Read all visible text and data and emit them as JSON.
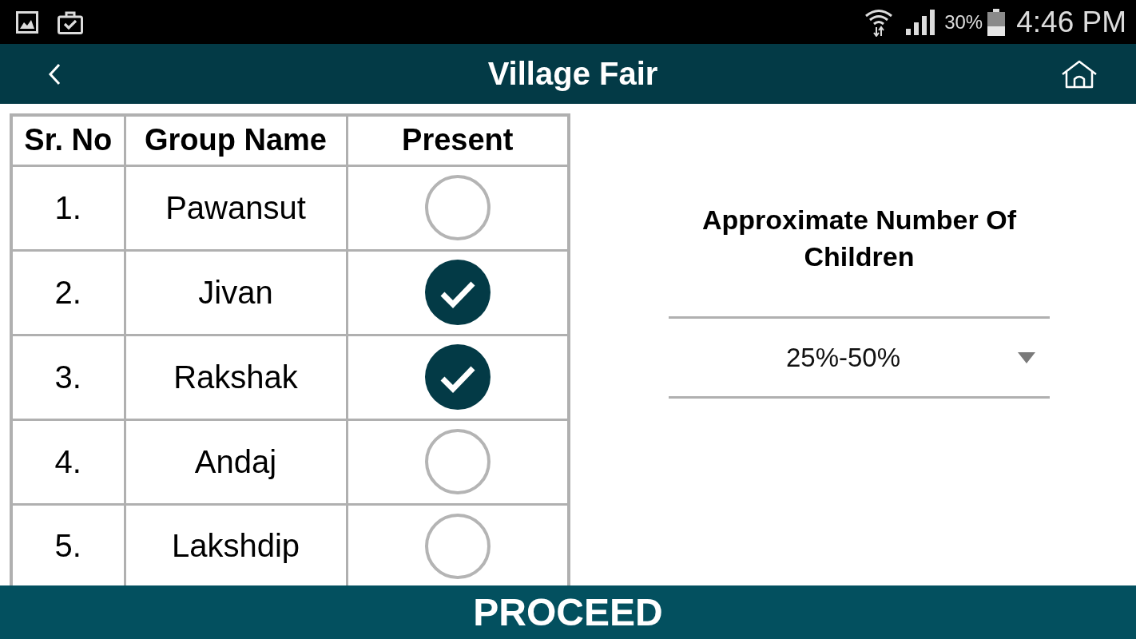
{
  "status_bar": {
    "battery": "30%",
    "time": "4:46 PM"
  },
  "app_bar": {
    "title": "Village Fair"
  },
  "table": {
    "columns": [
      "Sr. No",
      "Group Name",
      "Present"
    ],
    "rows": [
      {
        "sr_no": "1.",
        "group_name": "Pawansut",
        "present": false
      },
      {
        "sr_no": "2.",
        "group_name": "Jivan",
        "present": true
      },
      {
        "sr_no": "3.",
        "group_name": "Rakshak",
        "present": true
      },
      {
        "sr_no": "4.",
        "group_name": "Andaj",
        "present": false
      },
      {
        "sr_no": "5.",
        "group_name": "Lakshdip",
        "present": false
      }
    ]
  },
  "children_field": {
    "label": "Approximate Number Of Children",
    "value": "25%-50%"
  },
  "proceed_button": {
    "label": "PROCEED"
  }
}
